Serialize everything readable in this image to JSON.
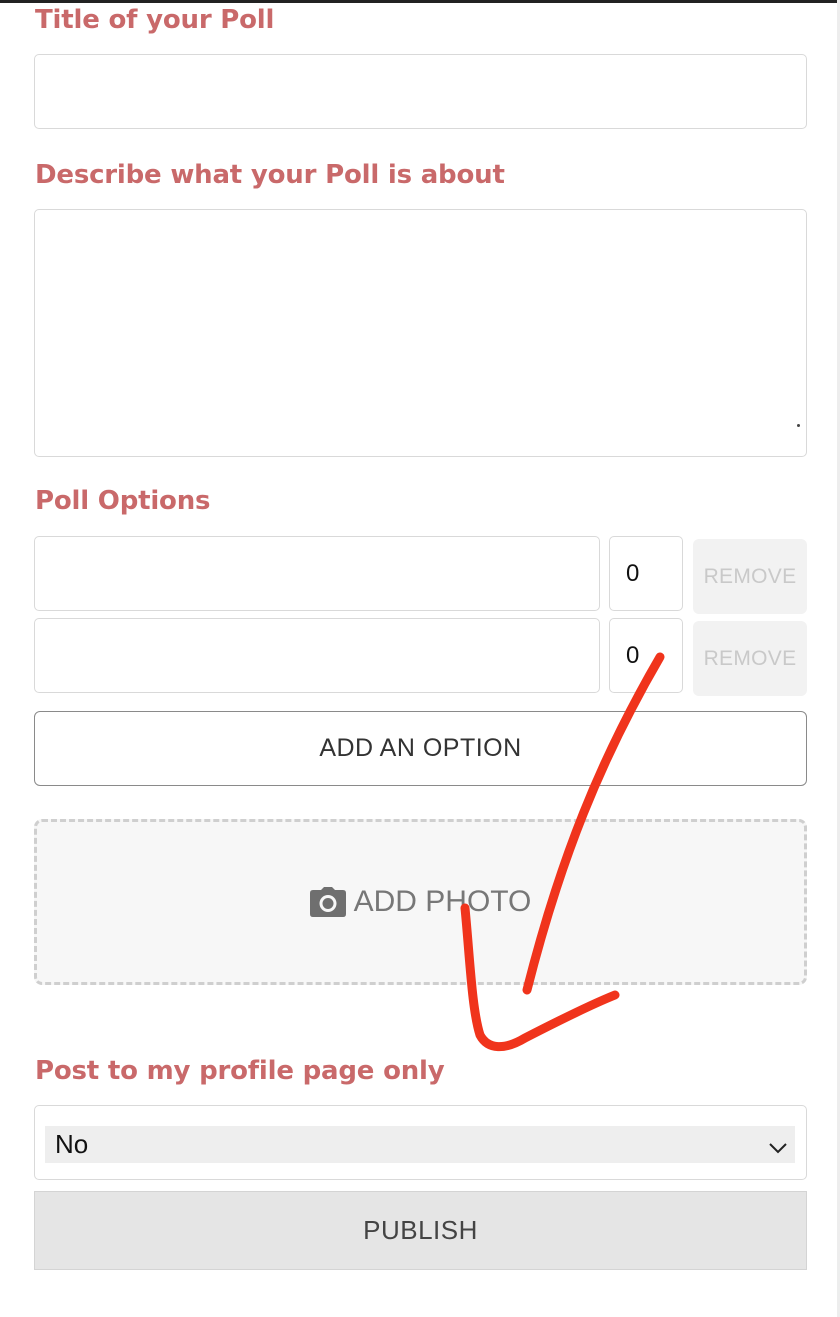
{
  "form": {
    "title_label": "Title of your Poll",
    "title_value": "",
    "description_label": "Describe what your Poll is about",
    "description_value": "",
    "options_label": "Poll Options",
    "options": [
      {
        "value": "",
        "count": "0",
        "remove_label": "REMOVE"
      },
      {
        "value": "",
        "count": "0",
        "remove_label": "REMOVE"
      }
    ],
    "add_option_label": "ADD AN OPTION",
    "add_photo_label": "ADD PHOTO",
    "add_photo_icon": "camera-icon",
    "profile_only_label": "Post to my profile page only",
    "profile_only_selected": "No",
    "publish_label": "PUBLISH"
  },
  "colors": {
    "label": "#c9696a",
    "annotation_stroke": "#f0341c"
  }
}
